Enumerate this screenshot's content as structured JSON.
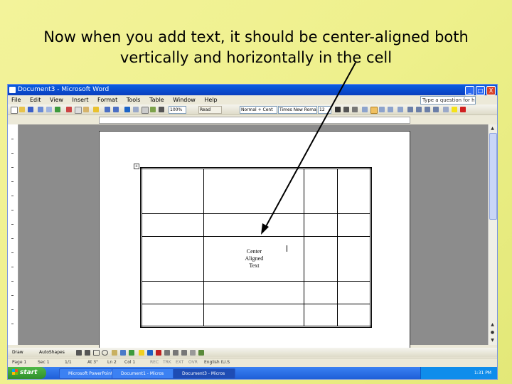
{
  "caption": {
    "line1": "Now when you add text, it should be center-aligned both",
    "line2": "vertically and horizontally in the cell"
  },
  "window": {
    "title": "Document3 - Microsoft Word",
    "buttons": [
      "_",
      "□",
      "X"
    ]
  },
  "menu": [
    "File",
    "Edit",
    "View",
    "Insert",
    "Format",
    "Tools",
    "Table",
    "Window",
    "Help"
  ],
  "help_box": "Type a question for help",
  "toolbar": {
    "zoom": "100%",
    "read": "Read",
    "style": "Normal + Cent",
    "font": "Times New Roman",
    "size": "12"
  },
  "document": {
    "cell_text": [
      "Center",
      "Aligned",
      "Text"
    ]
  },
  "status": {
    "page": "Page 1",
    "sec": "Sec 1",
    "pages": "1/1",
    "at": "At 3\"",
    "ln": "Ln 2",
    "col": "Col 1",
    "rec": "REC",
    "trk": "TRK",
    "ext": "EXT",
    "ovr": "OVR",
    "lang": "English (U.S"
  },
  "draw_toolbar": {
    "draw": "Draw",
    "autoshapes": "AutoShapes"
  },
  "taskbar": {
    "start": "start",
    "tasks": [
      "Microsoft PowerPoint",
      "Document1 - Micros",
      "Document3 - Micros"
    ],
    "clock": "1:31 PM"
  },
  "colors": {
    "background": "#eef08c",
    "title_bar": "#0a4fd0",
    "start_button": "#3da53a",
    "taskbar": "#2a6ee6"
  }
}
